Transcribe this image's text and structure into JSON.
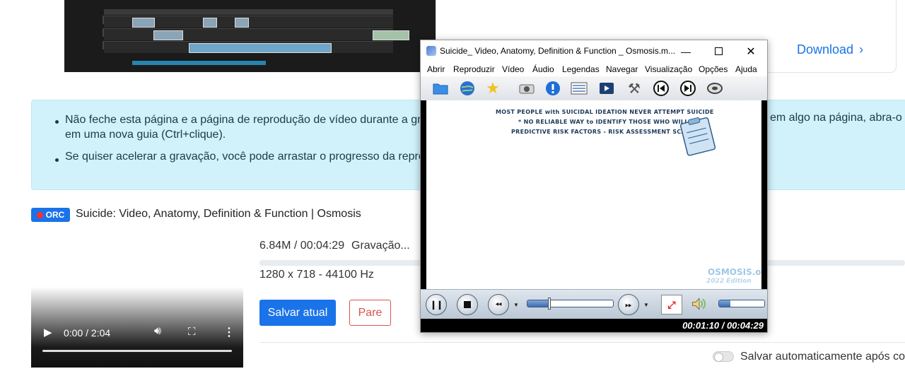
{
  "top": {
    "download_label": "Download"
  },
  "info": {
    "line1_start": "Não feche esta página e a página de reprodução de vídeo durante a gra",
    "line1_end": "em algo na página, abra-o",
    "line1_cont": "em uma nova guia (Ctrl+clique).",
    "line2": "Se quiser acelerar a gravação, você pode arrastar o progresso da reprod"
  },
  "recording": {
    "badge": "ORC",
    "title": "Suicide: Video, Anatomy, Definition & Function | Osmosis",
    "size_time": "6.84M / 00:04:29",
    "status": "Gravação...",
    "resolution": "1280 x 718 - 44100 Hz",
    "save_label": "Salvar atual",
    "stop_label": "Pare",
    "auto_save_label": "Salvar automaticamente após con",
    "progress": 0
  },
  "video": {
    "time": "0:00 / 2:04",
    "progress": 0
  },
  "player": {
    "window_title": "Suicide_ Video, Anatomy, Definition & Function _ Osmosis.m...",
    "menu": [
      "Abrir",
      "Reproduzir",
      "Vídeo",
      "Áudio",
      "Legendas",
      "Navegar",
      "Visualização",
      "Opções",
      "Ajuda"
    ],
    "toolbar_icons": [
      "open-folder-icon",
      "globe-icon",
      "favorites-star-icon",
      "screenshot-camera-icon",
      "info-icon",
      "playlist-icon",
      "video-settings-icon",
      "tools-icon",
      "previous-icon",
      "next-icon",
      "eject-icon"
    ],
    "frame_text": {
      "line1": "MOST PEOPLE with SUICIDAL IDEATION NEVER ATTEMPT SUICIDE",
      "line2": "* NO RELIABLE WAY to IDENTIFY THOSE WHO WILL",
      "line3": "PREDICTIVE RISK FACTORS - RISK ASSESSMENT SCALE",
      "logo": "OSMOSIS.org",
      "edition": "2022 Edition"
    },
    "timecode": "00:01:10 / 00:04:29",
    "seek_fraction": 0.26,
    "volume_fraction": 0.25
  },
  "colors": {
    "accent": "#1a73e8",
    "info_bg": "#d1f2fa",
    "stop": "#d9534f",
    "rec_dot": "#ff2d2d"
  }
}
